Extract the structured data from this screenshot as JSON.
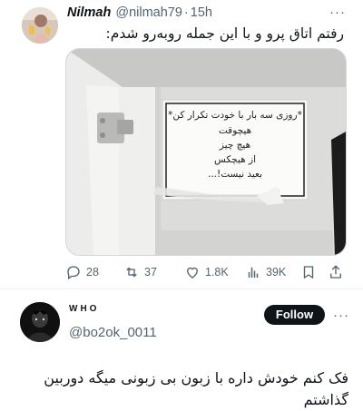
{
  "tweet": {
    "author_name": "Nilmah",
    "handle": "@nilmah79",
    "separator": "·",
    "time": "15h",
    "more": "···",
    "text": "رفتم اتاق پرو و با این جمله روبه‌رو شدم:",
    "note": {
      "line1": "*روزی سه بار با خودت تکرار کن*",
      "line2": "هیچوقت",
      "line3": "هیچ چیز",
      "line4": "از هیچکس",
      "line5": "بعید نیست!..."
    },
    "actions": {
      "replies": "28",
      "retweets": "37",
      "likes": "1.8K",
      "views": "39K"
    }
  },
  "reply": {
    "name": "WHO",
    "handle": "@bo2ok_0011",
    "follow_label": "Follow",
    "more": "···",
    "text": "فک کنم خودش داره با زبون بی زبونی میگه دوربین گذاشتم"
  },
  "colors": {
    "text_primary": "#0f1419",
    "text_secondary": "#536471",
    "button_bg": "#0f1419",
    "button_text": "#ffffff",
    "divider": "#eff3f4"
  }
}
